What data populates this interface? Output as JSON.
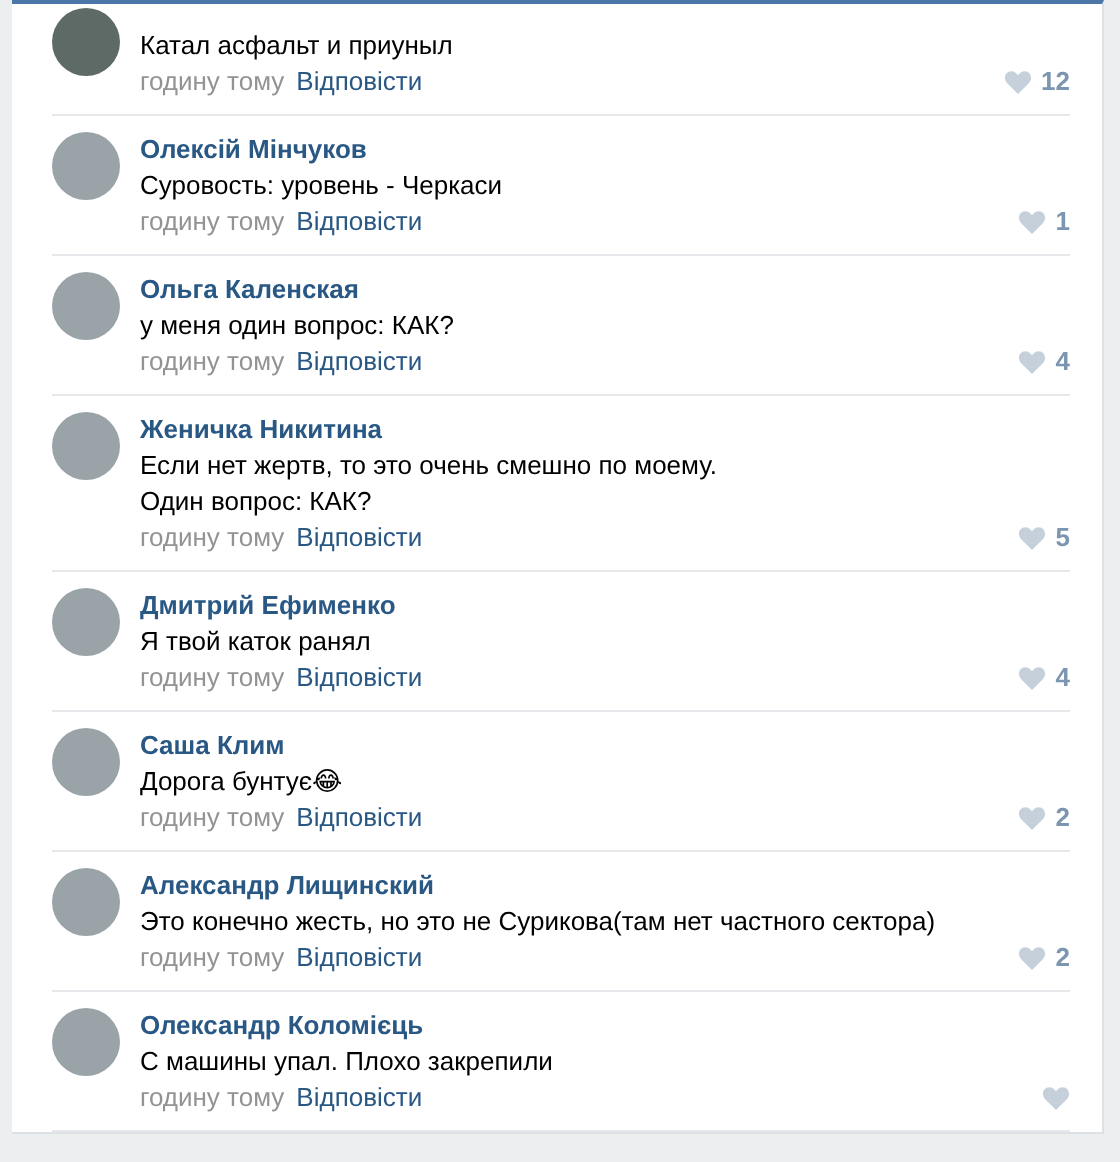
{
  "comments": [
    {
      "lines": [
        "Катал асфальт и приуныл"
      ],
      "time": "годину тому",
      "reply": "Відповісти",
      "likes": "12"
    },
    {
      "author": "Олексій Мінчуков",
      "lines": [
        "Суровость: уровень - Черкаси"
      ],
      "time": "годину тому",
      "reply": "Відповісти",
      "likes": "1"
    },
    {
      "author": "Ольга Каленская",
      "lines": [
        "у меня один вопрос: КАК?"
      ],
      "time": "годину тому",
      "reply": "Відповісти",
      "likes": "4"
    },
    {
      "author": "Женичка Никитина",
      "lines": [
        "Если нет жертв, то это очень смешно по моему.",
        "Один вопрос: КАК?"
      ],
      "time": "годину тому",
      "reply": "Відповісти",
      "likes": "5"
    },
    {
      "author": "Дмитрий Ефименко",
      "lines": [
        "Я твой каток ранял"
      ],
      "time": "годину тому",
      "reply": "Відповісти",
      "likes": "4"
    },
    {
      "author": "Саша Клим",
      "lines": [
        "Дорога бунтує😂"
      ],
      "time": "годину тому",
      "reply": "Відповісти",
      "likes": "2"
    },
    {
      "author": "Александр Лищинский",
      "lines": [
        "Это конечно жесть, но это не Сурикова(там нет частного сектора)"
      ],
      "time": "годину тому",
      "reply": "Відповісти",
      "likes": "2"
    },
    {
      "author": "Олександр Коломієць",
      "lines": [
        "С машины упал. Плохо закрепили"
      ],
      "time": "годину тому",
      "reply": "Відповісти"
    }
  ]
}
